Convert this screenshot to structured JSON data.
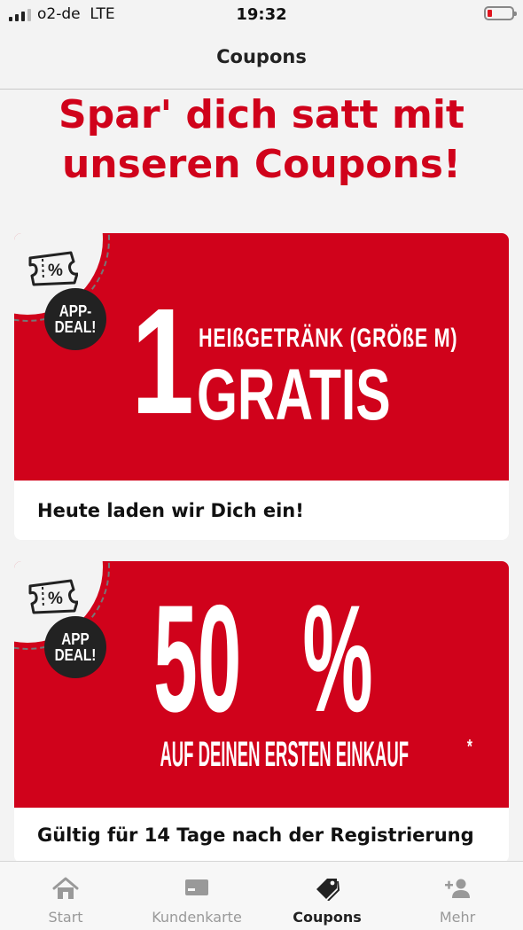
{
  "status_bar": {
    "carrier": "o2-de",
    "network": "LTE",
    "time": "19:32",
    "signal_bars": 4,
    "signal_active": 3,
    "battery_level": 0.1,
    "battery_color": "#e0141e"
  },
  "nav": {
    "title": "Coupons"
  },
  "headline": {
    "line1": "Spar' dich satt mit",
    "line2": "unseren Coupons!"
  },
  "colors": {
    "brand_red": "#d0021b",
    "badge_dark": "#222222",
    "background": "#f3f3f3"
  },
  "coupons": [
    {
      "icon": "ticket-percent-icon",
      "badge_line1": "APP-",
      "badge_line2": "DEAL!",
      "big_number": "1",
      "subtitle": "HEIßGETRÄNK (GRÖßE M)",
      "title": "GRATIS",
      "caption": "Heute laden wir Dich ein!"
    },
    {
      "icon": "ticket-percent-icon",
      "badge_line1": "APP",
      "badge_line2": "DEAL!",
      "big_number": "50",
      "percent_sign": "%",
      "subtitle": "AUF DEINEN ERSTEN EINKAUF",
      "footnote_mark": "*",
      "caption": "Gültig für 14 Tage nach der Registrierung"
    }
  ],
  "tabs": [
    {
      "label": "Start",
      "icon": "home-icon",
      "active": false
    },
    {
      "label": "Kundenkarte",
      "icon": "card-icon",
      "active": false
    },
    {
      "label": "Coupons",
      "icon": "tag-icon",
      "active": true
    },
    {
      "label": "Mehr",
      "icon": "add-person-icon",
      "active": false
    }
  ]
}
